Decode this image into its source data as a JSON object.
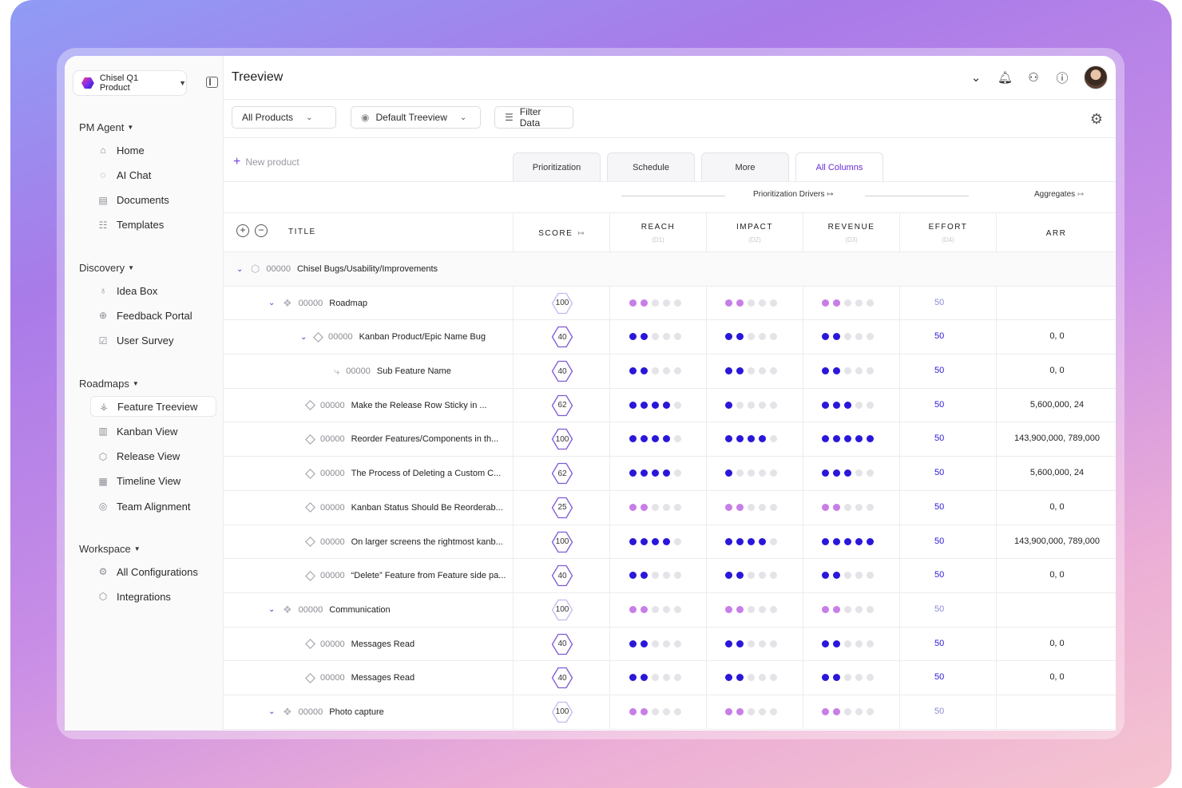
{
  "sidebar": {
    "product_name": "Chisel Q1 Product",
    "sections": [
      {
        "title": "PM Agent",
        "items": [
          {
            "label": "Home",
            "icon": "home-icon"
          },
          {
            "label": "AI Chat",
            "icon": "chat-icon"
          },
          {
            "label": "Documents",
            "icon": "document-icon"
          },
          {
            "label": "Templates",
            "icon": "template-icon"
          }
        ]
      },
      {
        "title": "Discovery",
        "items": [
          {
            "label": "Idea Box",
            "icon": "lightbulb-icon"
          },
          {
            "label": "Feedback Portal",
            "icon": "globe-icon"
          },
          {
            "label": "User Survey",
            "icon": "clipboard-icon"
          }
        ]
      },
      {
        "title": "Roadmaps",
        "items": [
          {
            "label": "Feature Treeview",
            "icon": "tree-icon",
            "active": true
          },
          {
            "label": "Kanban View",
            "icon": "kanban-icon"
          },
          {
            "label": "Release View",
            "icon": "cube-icon"
          },
          {
            "label": "Timeline View",
            "icon": "timeline-icon"
          },
          {
            "label": "Team Alignment",
            "icon": "target-icon"
          }
        ]
      },
      {
        "title": "Workspace",
        "items": [
          {
            "label": "All Configurations",
            "icon": "gear-icon"
          },
          {
            "label": "Integrations",
            "icon": "hexagon-icon"
          }
        ]
      }
    ]
  },
  "header": {
    "title": "Treeview"
  },
  "toolbar": {
    "products": "All Products",
    "view": "Default Treeview",
    "filter": "Filter Data"
  },
  "new_product": "New product",
  "tabs": [
    "Prioritization",
    "Schedule",
    "More",
    "All Columns"
  ],
  "active_tab": "All Columns",
  "groups": {
    "drivers": "Prioritization Drivers",
    "aggregates": "Aggregates"
  },
  "columns": {
    "title": "TITLE",
    "score": "SCORE",
    "reach": "REACH",
    "reach_sub": "(D1)",
    "impact": "IMPACT",
    "impact_sub": "(D2)",
    "revenue": "REVENUE",
    "revenue_sub": "(D3)",
    "effort": "EFFORT",
    "effort_sub": "(D4)",
    "arr": "ARR"
  },
  "colors": {
    "accent": "#6a2cd8",
    "dot_strong": "#2a17d9",
    "dot_light": "#c77ee6"
  },
  "rows": [
    {
      "level": 0,
      "kind": "product",
      "num": "00000",
      "title": "Chisel Bugs/Usability/Improvements",
      "expanded": true
    },
    {
      "level": 1,
      "kind": "component",
      "num": "00000",
      "title": "Roadmap",
      "score": "100",
      "reach": 2,
      "impact": 2,
      "revenue": 2,
      "tone": "light",
      "effort": "50",
      "arr": ""
    },
    {
      "level": 2,
      "kind": "feature-parent",
      "num": "00000",
      "title": "Kanban Product/Epic Name Bug",
      "score": "40",
      "reach": 2,
      "impact": 2,
      "revenue": 2,
      "tone": "strong",
      "effort": "50",
      "arr": "0, 0"
    },
    {
      "level": 3,
      "kind": "subfeature",
      "num": "00000",
      "title": "Sub Feature Name",
      "score": "40",
      "reach": 2,
      "impact": 2,
      "revenue": 2,
      "tone": "strong",
      "effort": "50",
      "arr": "0, 0"
    },
    {
      "level": 2,
      "kind": "feature",
      "num": "00000",
      "title": "Make the Release Row Sticky in ...",
      "score": "62",
      "reach": 4,
      "impact": 1,
      "revenue": 3,
      "tone": "strong",
      "effort": "50",
      "arr": "5,600,000, 24"
    },
    {
      "level": 2,
      "kind": "feature",
      "num": "00000",
      "title": "Reorder Features/Components in th...",
      "score": "100",
      "reach": 4,
      "impact": 4,
      "revenue": 5,
      "tone": "strong",
      "effort": "50",
      "arr": "143,900,000, 789,000"
    },
    {
      "level": 2,
      "kind": "feature",
      "num": "00000",
      "title": "The Process of Deleting a Custom C...",
      "score": "62",
      "reach": 4,
      "impact": 1,
      "revenue": 3,
      "tone": "strong",
      "effort": "50",
      "arr": "5,600,000, 24"
    },
    {
      "level": 2,
      "kind": "feature",
      "num": "00000",
      "title": "Kanban Status Should Be Reorderab...",
      "score": "25",
      "reach": 2,
      "impact": 2,
      "revenue": 2,
      "tone": "light",
      "effort": "50",
      "arr": "0, 0"
    },
    {
      "level": 2,
      "kind": "feature",
      "num": "00000",
      "title": "On larger screens the rightmost kanb...",
      "score": "100",
      "reach": 4,
      "impact": 4,
      "revenue": 5,
      "tone": "strong",
      "effort": "50",
      "arr": "143,900,000, 789,000"
    },
    {
      "level": 2,
      "kind": "feature",
      "num": "00000",
      "title": "“Delete” Feature from Feature side pa...",
      "score": "40",
      "reach": 2,
      "impact": 2,
      "revenue": 2,
      "tone": "strong",
      "effort": "50",
      "arr": "0, 0"
    },
    {
      "level": 1,
      "kind": "component",
      "num": "00000",
      "title": "Communication",
      "score": "100",
      "reach": 2,
      "impact": 2,
      "revenue": 2,
      "tone": "light",
      "effort": "50",
      "arr": ""
    },
    {
      "level": 2,
      "kind": "feature",
      "num": "00000",
      "title": "Messages Read",
      "score": "40",
      "reach": 2,
      "impact": 2,
      "revenue": 2,
      "tone": "strong",
      "effort": "50",
      "arr": "0, 0"
    },
    {
      "level": 2,
      "kind": "feature",
      "num": "00000",
      "title": "Messages Read",
      "score": "40",
      "reach": 2,
      "impact": 2,
      "revenue": 2,
      "tone": "strong",
      "effort": "50",
      "arr": "0, 0"
    },
    {
      "level": 1,
      "kind": "component",
      "num": "00000",
      "title": "Photo capture",
      "score": "100",
      "reach": 2,
      "impact": 2,
      "revenue": 2,
      "tone": "light",
      "effort": "50",
      "arr": ""
    }
  ]
}
